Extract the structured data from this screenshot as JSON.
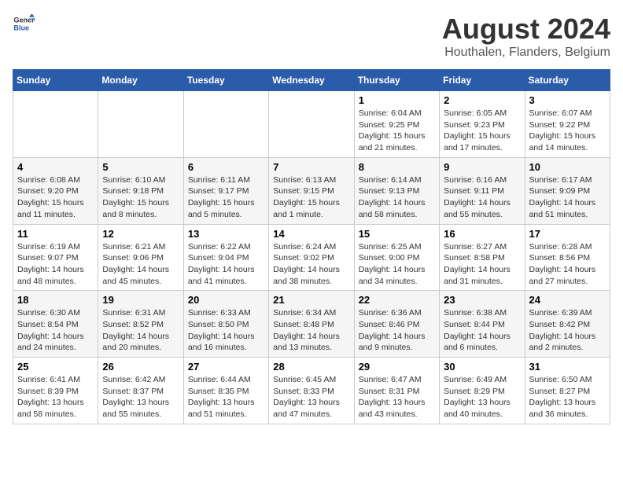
{
  "header": {
    "logo_general": "General",
    "logo_blue": "Blue",
    "main_title": "August 2024",
    "subtitle": "Houthalen, Flanders, Belgium"
  },
  "weekdays": [
    "Sunday",
    "Monday",
    "Tuesday",
    "Wednesday",
    "Thursday",
    "Friday",
    "Saturday"
  ],
  "weeks": [
    [
      {
        "day": "",
        "info": ""
      },
      {
        "day": "",
        "info": ""
      },
      {
        "day": "",
        "info": ""
      },
      {
        "day": "",
        "info": ""
      },
      {
        "day": "1",
        "info": "Sunrise: 6:04 AM\nSunset: 9:25 PM\nDaylight: 15 hours\nand 21 minutes."
      },
      {
        "day": "2",
        "info": "Sunrise: 6:05 AM\nSunset: 9:23 PM\nDaylight: 15 hours\nand 17 minutes."
      },
      {
        "day": "3",
        "info": "Sunrise: 6:07 AM\nSunset: 9:22 PM\nDaylight: 15 hours\nand 14 minutes."
      }
    ],
    [
      {
        "day": "4",
        "info": "Sunrise: 6:08 AM\nSunset: 9:20 PM\nDaylight: 15 hours\nand 11 minutes."
      },
      {
        "day": "5",
        "info": "Sunrise: 6:10 AM\nSunset: 9:18 PM\nDaylight: 15 hours\nand 8 minutes."
      },
      {
        "day": "6",
        "info": "Sunrise: 6:11 AM\nSunset: 9:17 PM\nDaylight: 15 hours\nand 5 minutes."
      },
      {
        "day": "7",
        "info": "Sunrise: 6:13 AM\nSunset: 9:15 PM\nDaylight: 15 hours\nand 1 minute."
      },
      {
        "day": "8",
        "info": "Sunrise: 6:14 AM\nSunset: 9:13 PM\nDaylight: 14 hours\nand 58 minutes."
      },
      {
        "day": "9",
        "info": "Sunrise: 6:16 AM\nSunset: 9:11 PM\nDaylight: 14 hours\nand 55 minutes."
      },
      {
        "day": "10",
        "info": "Sunrise: 6:17 AM\nSunset: 9:09 PM\nDaylight: 14 hours\nand 51 minutes."
      }
    ],
    [
      {
        "day": "11",
        "info": "Sunrise: 6:19 AM\nSunset: 9:07 PM\nDaylight: 14 hours\nand 48 minutes."
      },
      {
        "day": "12",
        "info": "Sunrise: 6:21 AM\nSunset: 9:06 PM\nDaylight: 14 hours\nand 45 minutes."
      },
      {
        "day": "13",
        "info": "Sunrise: 6:22 AM\nSunset: 9:04 PM\nDaylight: 14 hours\nand 41 minutes."
      },
      {
        "day": "14",
        "info": "Sunrise: 6:24 AM\nSunset: 9:02 PM\nDaylight: 14 hours\nand 38 minutes."
      },
      {
        "day": "15",
        "info": "Sunrise: 6:25 AM\nSunset: 9:00 PM\nDaylight: 14 hours\nand 34 minutes."
      },
      {
        "day": "16",
        "info": "Sunrise: 6:27 AM\nSunset: 8:58 PM\nDaylight: 14 hours\nand 31 minutes."
      },
      {
        "day": "17",
        "info": "Sunrise: 6:28 AM\nSunset: 8:56 PM\nDaylight: 14 hours\nand 27 minutes."
      }
    ],
    [
      {
        "day": "18",
        "info": "Sunrise: 6:30 AM\nSunset: 8:54 PM\nDaylight: 14 hours\nand 24 minutes."
      },
      {
        "day": "19",
        "info": "Sunrise: 6:31 AM\nSunset: 8:52 PM\nDaylight: 14 hours\nand 20 minutes."
      },
      {
        "day": "20",
        "info": "Sunrise: 6:33 AM\nSunset: 8:50 PM\nDaylight: 14 hours\nand 16 minutes."
      },
      {
        "day": "21",
        "info": "Sunrise: 6:34 AM\nSunset: 8:48 PM\nDaylight: 14 hours\nand 13 minutes."
      },
      {
        "day": "22",
        "info": "Sunrise: 6:36 AM\nSunset: 8:46 PM\nDaylight: 14 hours\nand 9 minutes."
      },
      {
        "day": "23",
        "info": "Sunrise: 6:38 AM\nSunset: 8:44 PM\nDaylight: 14 hours\nand 6 minutes."
      },
      {
        "day": "24",
        "info": "Sunrise: 6:39 AM\nSunset: 8:42 PM\nDaylight: 14 hours\nand 2 minutes."
      }
    ],
    [
      {
        "day": "25",
        "info": "Sunrise: 6:41 AM\nSunset: 8:39 PM\nDaylight: 13 hours\nand 58 minutes."
      },
      {
        "day": "26",
        "info": "Sunrise: 6:42 AM\nSunset: 8:37 PM\nDaylight: 13 hours\nand 55 minutes."
      },
      {
        "day": "27",
        "info": "Sunrise: 6:44 AM\nSunset: 8:35 PM\nDaylight: 13 hours\nand 51 minutes."
      },
      {
        "day": "28",
        "info": "Sunrise: 6:45 AM\nSunset: 8:33 PM\nDaylight: 13 hours\nand 47 minutes."
      },
      {
        "day": "29",
        "info": "Sunrise: 6:47 AM\nSunset: 8:31 PM\nDaylight: 13 hours\nand 43 minutes."
      },
      {
        "day": "30",
        "info": "Sunrise: 6:49 AM\nSunset: 8:29 PM\nDaylight: 13 hours\nand 40 minutes."
      },
      {
        "day": "31",
        "info": "Sunrise: 6:50 AM\nSunset: 8:27 PM\nDaylight: 13 hours\nand 36 minutes."
      }
    ]
  ]
}
